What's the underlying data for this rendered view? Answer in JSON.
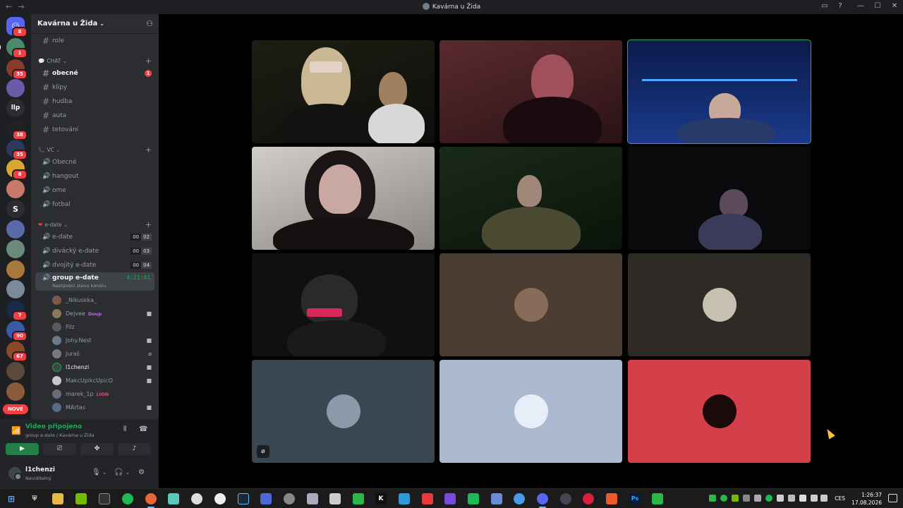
{
  "window": {
    "title": "Kavárna u Žida"
  },
  "server": {
    "name": "Kavárna u Žida"
  },
  "channels": {
    "top": [
      {
        "name": "role"
      }
    ],
    "chat_category": "CHAT",
    "chat": [
      {
        "name": "obecné",
        "unread": true,
        "mentions": "1"
      },
      {
        "name": "klipy"
      },
      {
        "name": "hudba"
      },
      {
        "name": "auta"
      },
      {
        "name": "tetování"
      }
    ],
    "vc_category": "VC",
    "vc": [
      {
        "name": "Obecné"
      },
      {
        "name": "hangout"
      },
      {
        "name": "ome"
      },
      {
        "name": "fotbal"
      }
    ],
    "edate_category": "e-date",
    "edate": [
      {
        "name": "e-date",
        "count": "00",
        "limit": "02"
      },
      {
        "name": "divácký e-date",
        "count": "00",
        "limit": "03"
      },
      {
        "name": "dvojitý e-date",
        "count": "00",
        "limit": "04"
      }
    ],
    "active": {
      "name": "group e-date",
      "timer": "4:21:41",
      "status_hint": "Nastavení stavu kanálu"
    }
  },
  "voice_users": [
    {
      "name": "_Nikuskka_",
      "color": "#7a5a4a"
    },
    {
      "name": "Dejvee",
      "tag": "Doup",
      "tag_color": "#b66fd8",
      "color": "#8a7a5a",
      "camera": true
    },
    {
      "name": "Filz",
      "color": "#5a5a5a"
    },
    {
      "name": "Johy.Nest",
      "color": "#6a7a8a",
      "camera": true
    },
    {
      "name": "Juraš",
      "color": "#7a7a7a",
      "muted": true
    },
    {
      "name": "l1chenzi",
      "color": "#3a4a3e",
      "camera": true,
      "me": true
    },
    {
      "name": "MakcUpikcUpicO",
      "color": "#c8c8c8",
      "camera": true
    },
    {
      "name": "marek_1p",
      "tag": "LION",
      "tag_color": "#e84a5f",
      "color": "#6a6a7a"
    },
    {
      "name": "MArtas",
      "color": "#5a6a8a",
      "camera": true
    }
  ],
  "voice_panel": {
    "status": "Video připojeno",
    "location": "group e-date / Kavárna u Žida"
  },
  "user": {
    "name": "l1chenzi",
    "status": "Neviditelný"
  },
  "guild_badges": [
    "8",
    "1",
    "35",
    "38",
    "35",
    "8",
    "7",
    "90",
    "67"
  ],
  "guild_letters": {
    "llp": "llp",
    "s": "S",
    "new": "NOVÉ"
  },
  "taskbar": {
    "time": "1:26:37",
    "date": "17.08.2026",
    "language": "CES",
    "apps": [
      "K",
      "Ps"
    ]
  },
  "colors": {
    "speaking": "#3ba55d",
    "online": "#23a55a",
    "mention": "#f23f43"
  }
}
